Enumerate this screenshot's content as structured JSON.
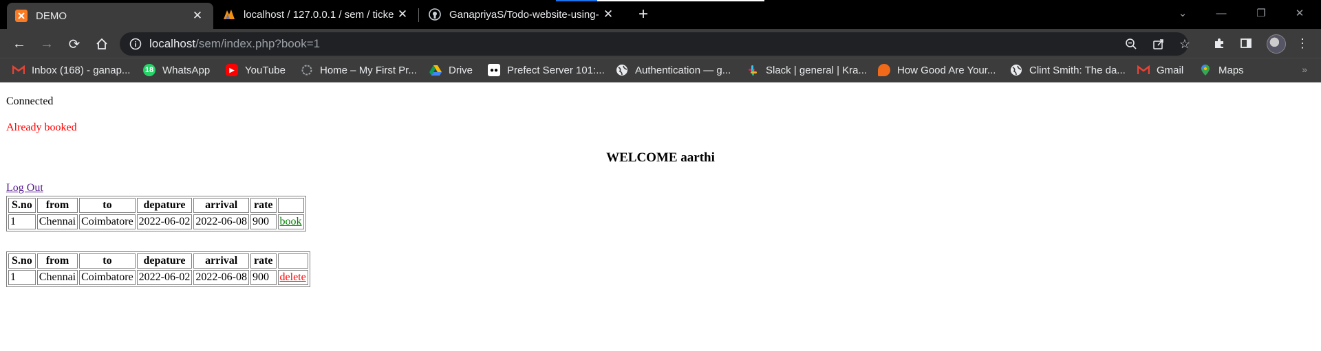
{
  "browser": {
    "tabs": [
      {
        "title": "DEMO",
        "icon": "xampp-icon",
        "active": true
      },
      {
        "title": "localhost / 127.0.0.1 / sem / ticke",
        "icon": "phpmyadmin-icon",
        "active": false
      },
      {
        "title": "GanapriyaS/Todo-website-using-",
        "icon": "github-icon",
        "active": false
      }
    ],
    "url_host": "localhost",
    "url_path": "/sem/index.php?book=1",
    "bookmarks": [
      {
        "label": "Inbox (168) - ganap...",
        "icon": "gmail-icon"
      },
      {
        "label": "WhatsApp",
        "icon": "whatsapp-icon",
        "badge": "18"
      },
      {
        "label": "YouTube",
        "icon": "youtube-icon"
      },
      {
        "label": "Home – My First Pr...",
        "icon": "wordpress-icon"
      },
      {
        "label": "Drive",
        "icon": "drive-icon"
      },
      {
        "label": "Prefect Server 101:...",
        "icon": "medium-icon"
      },
      {
        "label": "Authentication — g...",
        "icon": "globe-icon"
      },
      {
        "label": "Slack | general | Kra...",
        "icon": "slack-icon"
      },
      {
        "label": "How Good Are Your...",
        "icon": "orange-chat-icon"
      },
      {
        "label": "Clint Smith: The da...",
        "icon": "globe-icon"
      },
      {
        "label": "Gmail",
        "icon": "gmail-icon"
      },
      {
        "label": "Maps",
        "icon": "maps-icon"
      }
    ]
  },
  "page": {
    "status": "Connected",
    "message": "Already booked",
    "welcome": "WELCOME aarthi",
    "logout": "Log Out",
    "headers": [
      "S.no",
      "from",
      "to",
      "depature",
      "arrival",
      "rate"
    ],
    "available": [
      {
        "sno": "1",
        "from": "Chennai",
        "to": "Coimbatore",
        "departure": "2022-06-02",
        "arrival": "2022-06-08",
        "rate": "900",
        "action": "book"
      }
    ],
    "booked": [
      {
        "sno": "1",
        "from": "Chennai",
        "to": "Coimbatore",
        "departure": "2022-06-02",
        "arrival": "2022-06-08",
        "rate": "900",
        "action": "delete"
      }
    ]
  },
  "colors": {
    "tabstrip": "#000000",
    "toolbar": "#3c3c3c",
    "message": "#ff0000",
    "book_link": "#008000",
    "delete_link": "#ff0000",
    "visited_link": "#551a8b"
  }
}
